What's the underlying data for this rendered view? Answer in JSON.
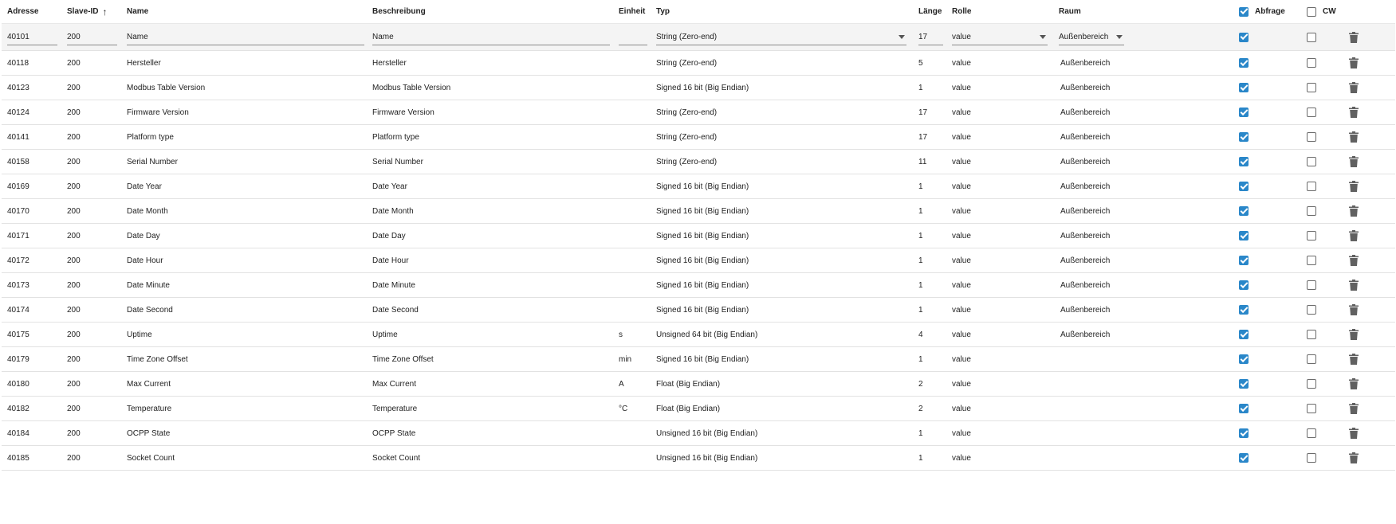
{
  "header": {
    "address": "Adresse",
    "slave_id": "Slave-ID",
    "sort_arrow": "↑",
    "name": "Name",
    "description": "Beschreibung",
    "unit": "Einheit",
    "type": "Typ",
    "length": "Länge",
    "role": "Rolle",
    "room": "Raum",
    "poll": "Abfrage",
    "cw": "CW",
    "poll_checked": true,
    "cw_checked": false
  },
  "edit_row": {
    "address": "40101",
    "slave_id": "200",
    "name": "Name",
    "description": "Name",
    "unit": "",
    "type": "String (Zero-end)",
    "length": "17",
    "role": "value",
    "room": "Außenbereich",
    "poll": true,
    "cw": false
  },
  "rows": [
    {
      "address": "40118",
      "slave_id": "200",
      "name": "Hersteller",
      "description": "Hersteller",
      "unit": "",
      "type": "String (Zero-end)",
      "length": "5",
      "role": "value",
      "room": "Außenbereich",
      "poll": true,
      "cw": false
    },
    {
      "address": "40123",
      "slave_id": "200",
      "name": "Modbus Table Version",
      "description": "Modbus Table Version",
      "unit": "",
      "type": "Signed 16 bit (Big Endian)",
      "length": "1",
      "role": "value",
      "room": "Außenbereich",
      "poll": true,
      "cw": false
    },
    {
      "address": "40124",
      "slave_id": "200",
      "name": "Firmware Version",
      "description": "Firmware Version",
      "unit": "",
      "type": "String (Zero-end)",
      "length": "17",
      "role": "value",
      "room": "Außenbereich",
      "poll": true,
      "cw": false
    },
    {
      "address": "40141",
      "slave_id": "200",
      "name": "Platform type",
      "description": "Platform type",
      "unit": "",
      "type": "String (Zero-end)",
      "length": "17",
      "role": "value",
      "room": "Außenbereich",
      "poll": true,
      "cw": false
    },
    {
      "address": "40158",
      "slave_id": "200",
      "name": "Serial Number",
      "description": "Serial Number",
      "unit": "",
      "type": "String (Zero-end)",
      "length": "11",
      "role": "value",
      "room": "Außenbereich",
      "poll": true,
      "cw": false
    },
    {
      "address": "40169",
      "slave_id": "200",
      "name": "Date Year",
      "description": "Date Year",
      "unit": "",
      "type": "Signed 16 bit (Big Endian)",
      "length": "1",
      "role": "value",
      "room": "Außenbereich",
      "poll": true,
      "cw": false
    },
    {
      "address": "40170",
      "slave_id": "200",
      "name": "Date Month",
      "description": "Date Month",
      "unit": "",
      "type": "Signed 16 bit (Big Endian)",
      "length": "1",
      "role": "value",
      "room": "Außenbereich",
      "poll": true,
      "cw": false
    },
    {
      "address": "40171",
      "slave_id": "200",
      "name": "Date Day",
      "description": "Date Day",
      "unit": "",
      "type": "Signed 16 bit (Big Endian)",
      "length": "1",
      "role": "value",
      "room": "Außenbereich",
      "poll": true,
      "cw": false
    },
    {
      "address": "40172",
      "slave_id": "200",
      "name": "Date Hour",
      "description": "Date Hour",
      "unit": "",
      "type": "Signed 16 bit (Big Endian)",
      "length": "1",
      "role": "value",
      "room": "Außenbereich",
      "poll": true,
      "cw": false
    },
    {
      "address": "40173",
      "slave_id": "200",
      "name": "Date Minute",
      "description": "Date Minute",
      "unit": "",
      "type": "Signed 16 bit (Big Endian)",
      "length": "1",
      "role": "value",
      "room": "Außenbereich",
      "poll": true,
      "cw": false
    },
    {
      "address": "40174",
      "slave_id": "200",
      "name": "Date Second",
      "description": "Date Second",
      "unit": "",
      "type": "Signed 16 bit (Big Endian)",
      "length": "1",
      "role": "value",
      "room": "Außenbereich",
      "poll": true,
      "cw": false
    },
    {
      "address": "40175",
      "slave_id": "200",
      "name": "Uptime",
      "description": "Uptime",
      "unit": "s",
      "type": "Unsigned 64 bit (Big Endian)",
      "length": "4",
      "role": "value",
      "room": "Außenbereich",
      "poll": true,
      "cw": false
    },
    {
      "address": "40179",
      "slave_id": "200",
      "name": "Time Zone Offset",
      "description": "Time Zone Offset",
      "unit": "min",
      "type": "Signed 16 bit (Big Endian)",
      "length": "1",
      "role": "value",
      "room": "",
      "poll": true,
      "cw": false
    },
    {
      "address": "40180",
      "slave_id": "200",
      "name": "Max Current",
      "description": "Max Current",
      "unit": "A",
      "type": "Float (Big Endian)",
      "length": "2",
      "role": "value",
      "room": "",
      "poll": true,
      "cw": false
    },
    {
      "address": "40182",
      "slave_id": "200",
      "name": "Temperature",
      "description": "Temperature",
      "unit": "°C",
      "type": "Float (Big Endian)",
      "length": "2",
      "role": "value",
      "room": "",
      "poll": true,
      "cw": false
    },
    {
      "address": "40184",
      "slave_id": "200",
      "name": "OCPP State",
      "description": "OCPP State",
      "unit": "",
      "type": "Unsigned 16 bit (Big Endian)",
      "length": "1",
      "role": "value",
      "room": "",
      "poll": true,
      "cw": false
    },
    {
      "address": "40185",
      "slave_id": "200",
      "name": "Socket Count",
      "description": "Socket Count",
      "unit": "",
      "type": "Unsigned 16 bit (Big Endian)",
      "length": "1",
      "role": "value",
      "room": "",
      "poll": true,
      "cw": false
    }
  ],
  "colors": {
    "checkbox_on": "#2a87c9",
    "trash": "#616161"
  },
  "icons": {
    "sort": "arrow-up-icon",
    "delete": "trash-icon",
    "dropdown": "caret-down-icon"
  }
}
